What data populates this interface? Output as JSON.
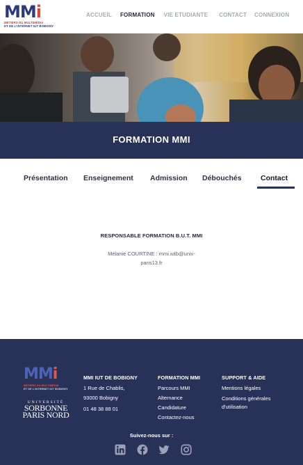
{
  "header": {
    "logo": {
      "mmi_prefix": "MM",
      "mmi_accent": "i",
      "line1": "MÉTIERS DU MULTIMÉDIA",
      "line2": "ET DE L'INTERNET IUT BOBIGNY"
    },
    "nav": [
      {
        "label": "ACCUEIL",
        "active": false
      },
      {
        "label": "FORMATION",
        "active": true
      },
      {
        "label": "VIE ETUDIANTE",
        "active": false
      },
      {
        "label": "CONTACT",
        "active": false
      },
      {
        "label": "CONNEXION",
        "active": false
      }
    ]
  },
  "banner": {
    "title": "FORMATION MMI"
  },
  "tabs": [
    {
      "label": "Présentation",
      "active": false
    },
    {
      "label": "Enseignement",
      "active": false
    },
    {
      "label": "Admission",
      "active": false
    },
    {
      "label": "Débouchés",
      "active": false
    },
    {
      "label": "Contact",
      "active": true
    }
  ],
  "contact": {
    "title": "RESPONSABLE FORMATION B.U.T. MMI",
    "line1": "Mélanie COURTINE : mmi.iutb@univ-",
    "line2": "paris13.fr"
  },
  "footer": {
    "sorbonne": {
      "line1": "UNIVERSITÉ",
      "line2": "SORBONNE",
      "line3": "PARIS NORD"
    },
    "columns": [
      {
        "title": "MMI IUT DE BOBIGNY",
        "lines": [
          "1 Rue de Chablis,",
          "93000 Bobigny",
          "01 48 38 88 01"
        ]
      },
      {
        "title": "FORMATION MMI",
        "lines": [
          "Parcours MMI",
          "Alternance",
          "Candidature",
          "Contactez-nous"
        ]
      },
      {
        "title": "SUPPORT & AIDE",
        "lines": [
          "Mentions légales",
          "Conditions générales",
          "d'utilisation"
        ]
      }
    ],
    "follow": "Suivez-nous sur :",
    "social": [
      "linkedin-icon",
      "facebook-icon",
      "twitter-icon",
      "instagram-icon"
    ]
  },
  "colors": {
    "navy": "#283259",
    "nav_inactive": "#a7a9b4",
    "brand_blue": "#2b3a7a",
    "brand_red": "#e0473a",
    "social_icons": "#9aa0b8"
  }
}
